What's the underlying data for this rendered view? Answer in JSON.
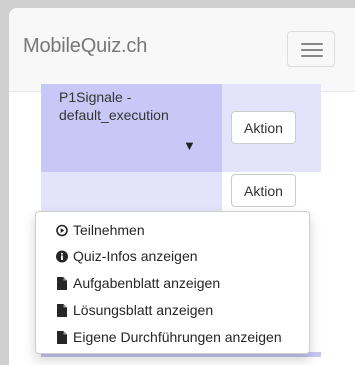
{
  "navbar": {
    "brand": "MobileQuiz.ch"
  },
  "quiz": {
    "title": "P1Signale - default_execution",
    "caret": "▼"
  },
  "actions": {
    "button1_label": "Aktion",
    "button2_label": "Aktion"
  },
  "dropdown": {
    "items": [
      {
        "label": "Teilnehmen",
        "icon": "play-circle-icon"
      },
      {
        "label": "Quiz-Infos anzeigen",
        "icon": "info-circle-icon"
      },
      {
        "label": "Aufgabenblatt anzeigen",
        "icon": "file-icon"
      },
      {
        "label": "Lösungsblatt anzeigen",
        "icon": "file-icon"
      },
      {
        "label": "Eigene Durchführungen anzeigen",
        "icon": "file-icon"
      }
    ]
  },
  "colors": {
    "row_highlight": "#c8c8f6",
    "row_light": "#e3e3fb",
    "navbar_bg": "#f8f8f8"
  }
}
